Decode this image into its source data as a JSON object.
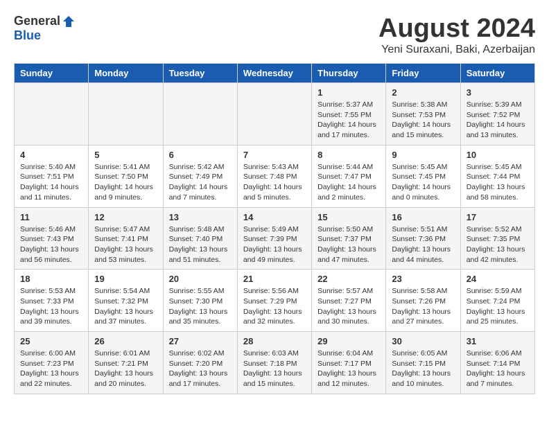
{
  "logo": {
    "general": "General",
    "blue": "Blue"
  },
  "title": {
    "month": "August 2024",
    "location": "Yeni Suraxani, Baki, Azerbaijan"
  },
  "weekdays": [
    "Sunday",
    "Monday",
    "Tuesday",
    "Wednesday",
    "Thursday",
    "Friday",
    "Saturday"
  ],
  "weeks": [
    [
      {
        "day": "",
        "info": ""
      },
      {
        "day": "",
        "info": ""
      },
      {
        "day": "",
        "info": ""
      },
      {
        "day": "",
        "info": ""
      },
      {
        "day": "1",
        "info": "Sunrise: 5:37 AM\nSunset: 7:55 PM\nDaylight: 14 hours\nand 17 minutes."
      },
      {
        "day": "2",
        "info": "Sunrise: 5:38 AM\nSunset: 7:53 PM\nDaylight: 14 hours\nand 15 minutes."
      },
      {
        "day": "3",
        "info": "Sunrise: 5:39 AM\nSunset: 7:52 PM\nDaylight: 14 hours\nand 13 minutes."
      }
    ],
    [
      {
        "day": "4",
        "info": "Sunrise: 5:40 AM\nSunset: 7:51 PM\nDaylight: 14 hours\nand 11 minutes."
      },
      {
        "day": "5",
        "info": "Sunrise: 5:41 AM\nSunset: 7:50 PM\nDaylight: 14 hours\nand 9 minutes."
      },
      {
        "day": "6",
        "info": "Sunrise: 5:42 AM\nSunset: 7:49 PM\nDaylight: 14 hours\nand 7 minutes."
      },
      {
        "day": "7",
        "info": "Sunrise: 5:43 AM\nSunset: 7:48 PM\nDaylight: 14 hours\nand 5 minutes."
      },
      {
        "day": "8",
        "info": "Sunrise: 5:44 AM\nSunset: 7:47 PM\nDaylight: 14 hours\nand 2 minutes."
      },
      {
        "day": "9",
        "info": "Sunrise: 5:45 AM\nSunset: 7:45 PM\nDaylight: 14 hours\nand 0 minutes."
      },
      {
        "day": "10",
        "info": "Sunrise: 5:45 AM\nSunset: 7:44 PM\nDaylight: 13 hours\nand 58 minutes."
      }
    ],
    [
      {
        "day": "11",
        "info": "Sunrise: 5:46 AM\nSunset: 7:43 PM\nDaylight: 13 hours\nand 56 minutes."
      },
      {
        "day": "12",
        "info": "Sunrise: 5:47 AM\nSunset: 7:41 PM\nDaylight: 13 hours\nand 53 minutes."
      },
      {
        "day": "13",
        "info": "Sunrise: 5:48 AM\nSunset: 7:40 PM\nDaylight: 13 hours\nand 51 minutes."
      },
      {
        "day": "14",
        "info": "Sunrise: 5:49 AM\nSunset: 7:39 PM\nDaylight: 13 hours\nand 49 minutes."
      },
      {
        "day": "15",
        "info": "Sunrise: 5:50 AM\nSunset: 7:37 PM\nDaylight: 13 hours\nand 47 minutes."
      },
      {
        "day": "16",
        "info": "Sunrise: 5:51 AM\nSunset: 7:36 PM\nDaylight: 13 hours\nand 44 minutes."
      },
      {
        "day": "17",
        "info": "Sunrise: 5:52 AM\nSunset: 7:35 PM\nDaylight: 13 hours\nand 42 minutes."
      }
    ],
    [
      {
        "day": "18",
        "info": "Sunrise: 5:53 AM\nSunset: 7:33 PM\nDaylight: 13 hours\nand 39 minutes."
      },
      {
        "day": "19",
        "info": "Sunrise: 5:54 AM\nSunset: 7:32 PM\nDaylight: 13 hours\nand 37 minutes."
      },
      {
        "day": "20",
        "info": "Sunrise: 5:55 AM\nSunset: 7:30 PM\nDaylight: 13 hours\nand 35 minutes."
      },
      {
        "day": "21",
        "info": "Sunrise: 5:56 AM\nSunset: 7:29 PM\nDaylight: 13 hours\nand 32 minutes."
      },
      {
        "day": "22",
        "info": "Sunrise: 5:57 AM\nSunset: 7:27 PM\nDaylight: 13 hours\nand 30 minutes."
      },
      {
        "day": "23",
        "info": "Sunrise: 5:58 AM\nSunset: 7:26 PM\nDaylight: 13 hours\nand 27 minutes."
      },
      {
        "day": "24",
        "info": "Sunrise: 5:59 AM\nSunset: 7:24 PM\nDaylight: 13 hours\nand 25 minutes."
      }
    ],
    [
      {
        "day": "25",
        "info": "Sunrise: 6:00 AM\nSunset: 7:23 PM\nDaylight: 13 hours\nand 22 minutes."
      },
      {
        "day": "26",
        "info": "Sunrise: 6:01 AM\nSunset: 7:21 PM\nDaylight: 13 hours\nand 20 minutes."
      },
      {
        "day": "27",
        "info": "Sunrise: 6:02 AM\nSunset: 7:20 PM\nDaylight: 13 hours\nand 17 minutes."
      },
      {
        "day": "28",
        "info": "Sunrise: 6:03 AM\nSunset: 7:18 PM\nDaylight: 13 hours\nand 15 minutes."
      },
      {
        "day": "29",
        "info": "Sunrise: 6:04 AM\nSunset: 7:17 PM\nDaylight: 13 hours\nand 12 minutes."
      },
      {
        "day": "30",
        "info": "Sunrise: 6:05 AM\nSunset: 7:15 PM\nDaylight: 13 hours\nand 10 minutes."
      },
      {
        "day": "31",
        "info": "Sunrise: 6:06 AM\nSunset: 7:14 PM\nDaylight: 13 hours\nand 7 minutes."
      }
    ]
  ]
}
